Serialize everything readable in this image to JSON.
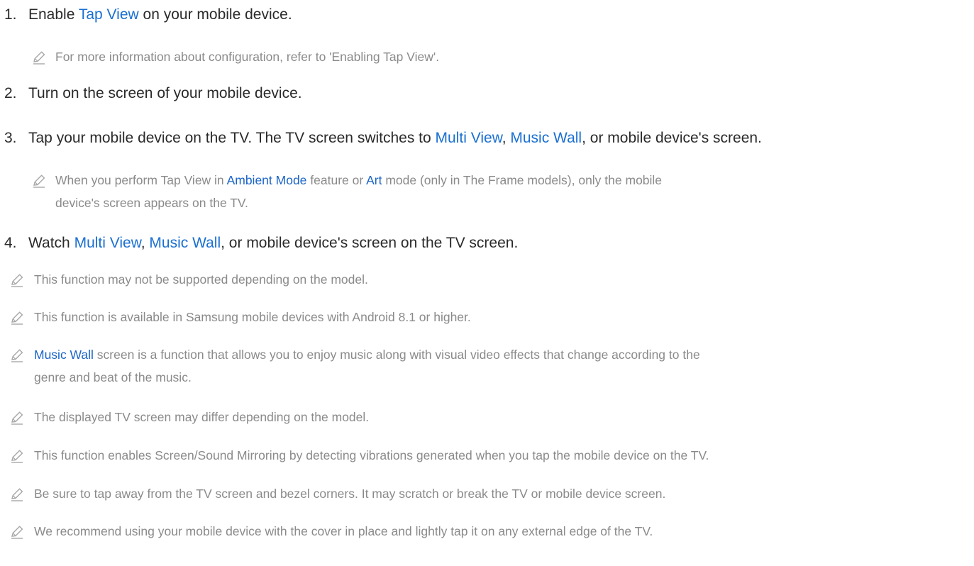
{
  "steps": [
    {
      "num": "1.",
      "before": "Enable ",
      "link": "Tap View",
      "after": " on your mobile device."
    },
    {
      "num": "2.",
      "text": "Turn on the screen of your mobile device."
    },
    {
      "num": "3.",
      "before": "Tap your mobile device on the TV. The TV screen switches to ",
      "link1": "Multi View",
      "sep": ", ",
      "link2": "Music Wall",
      "after": ", or mobile device's screen."
    },
    {
      "num": "4.",
      "before": "Watch ",
      "link1": "Multi View",
      "sep": ", ",
      "link2": "Music Wall",
      "after": ", or mobile device's screen on the TV screen."
    }
  ],
  "sub_notes": {
    "config": "For more information about configuration, refer to 'Enabling Tap View'.",
    "ambient": {
      "before": "When you perform Tap View in ",
      "link1": "Ambient Mode",
      "mid": " feature or ",
      "link2": "Art",
      "after_line1": " mode (only in The Frame models), only the mobile",
      "line2": "device's screen appears on the TV."
    }
  },
  "notes": [
    {
      "text": "This function may not be supported depending on the model."
    },
    {
      "text": "This function is available in Samsung mobile devices with Android 8.1 or higher."
    },
    {
      "link": "Music Wall",
      "after_line1": " screen is a function that allows you to enjoy music along with visual video effects that change according to the",
      "line2": "genre and beat of the music."
    },
    {
      "text": "The displayed TV screen may differ depending on the model."
    },
    {
      "text": "This function enables Screen/Sound Mirroring by detecting vibrations generated when you tap the mobile device on the TV."
    },
    {
      "text": "Be sure to tap away from the TV screen and bezel corners. It may scratch or break the TV or mobile device screen."
    },
    {
      "text": "We recommend using your mobile device with the cover in place and lightly tap it on any external edge of the TV."
    }
  ],
  "icons": {
    "note": "pencil-icon"
  },
  "colors": {
    "link": "#1a6fd1",
    "step_text": "#2a2a2a",
    "note_text": "#8a8a8a"
  }
}
